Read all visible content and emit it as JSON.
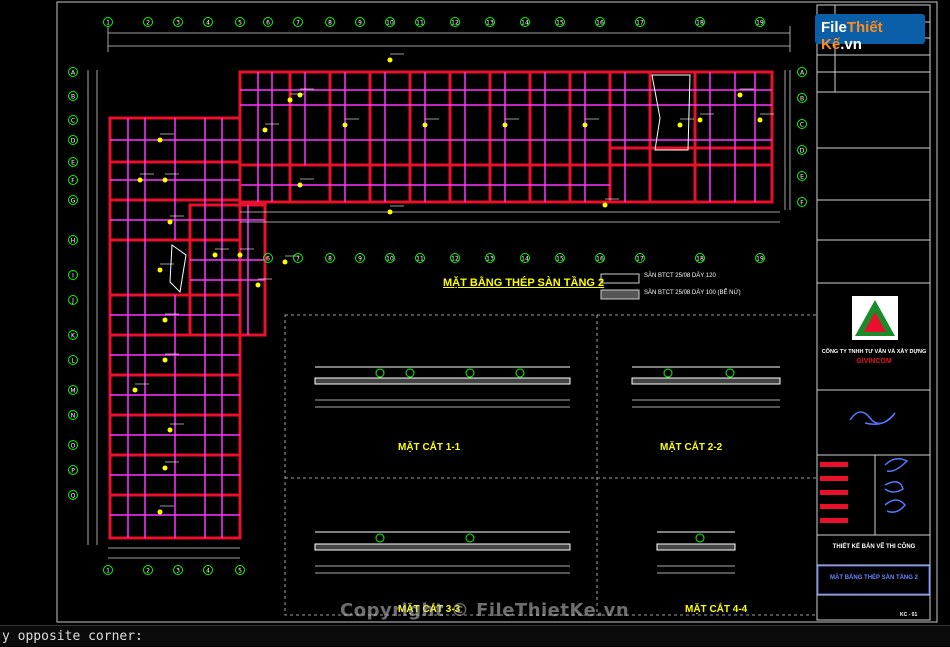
{
  "logo": {
    "main": "File",
    "accent": "Thiết Kế",
    "suffix": ".vn"
  },
  "plan_title": "MẶT BẰNG THÉP SÀN TẦNG 2",
  "legend": [
    {
      "text": "SÀN BTCT 25/08 DÀY 120"
    },
    {
      "text": "SÀN BTCT 25/08 DÀY 100 (BỂ NỨ)"
    }
  ],
  "sections": [
    {
      "label": "MẶT CẮT 1-1"
    },
    {
      "label": "MẶT CẮT 2-2"
    },
    {
      "label": "MẶT CẮT 3-3"
    },
    {
      "label": "MẶT CẮT 4-4"
    }
  ],
  "title_block": {
    "company": "CÔNG TY TNHH TƯ VẤN VÀ XÂY DỰNG",
    "company_name": "GIVINCOM",
    "stage": "THIẾT KẾ BẢN VẼ THI CÔNG",
    "sheet_title": "MẶT BẰNG THÉP SÀN TẦNG 2",
    "sheet_no": "KC - 01"
  },
  "command_line": "y opposite corner:",
  "watermark": "Copyright © FileThietKe.vn",
  "axes_top": [
    "1",
    "2",
    "3",
    "4",
    "5",
    "6",
    "7",
    "8",
    "9",
    "10",
    "11",
    "12",
    "13",
    "14",
    "15",
    "16",
    "17",
    "18",
    "19"
  ],
  "axes_left": [
    "A",
    "B",
    "C",
    "D",
    "E",
    "F",
    "G",
    "H",
    "I",
    "J",
    "K",
    "L",
    "M",
    "N",
    "O",
    "P",
    "Q"
  ],
  "colors": {
    "beam": "#e8102a",
    "rebar": "#ff33ff",
    "dim": "#ffffff",
    "tag": "#ffff00",
    "grid": "#00ff00"
  }
}
